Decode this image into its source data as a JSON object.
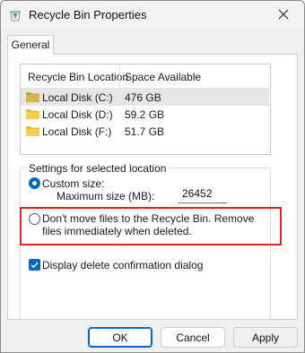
{
  "window": {
    "title": "Recycle Bin Properties",
    "icon": "recycle-bin-icon",
    "close_icon": "close-icon"
  },
  "tabs": [
    {
      "label": "General",
      "active": true
    }
  ],
  "list": {
    "columns": [
      "Recycle Bin Location",
      "Space Available"
    ],
    "rows": [
      {
        "location": "Local Disk (C:)",
        "space": "476 GB",
        "selected": true
      },
      {
        "location": "Local Disk (D:)",
        "space": "59.2 GB",
        "selected": false
      },
      {
        "location": "Local Disk (F:)",
        "space": "51.7 GB",
        "selected": false
      }
    ]
  },
  "settings": {
    "group_label": "Settings for selected location",
    "custom_size_label": "Custom size:",
    "custom_size_selected": true,
    "max_size_label": "Maximum size (MB):",
    "max_size_value": "26452",
    "dont_move_label": "Don't move files to the Recycle Bin. Remove files immediately when deleted.",
    "dont_move_selected": false,
    "confirm_label": "Display delete confirmation dialog",
    "confirm_checked": true
  },
  "buttons": {
    "ok": "OK",
    "cancel": "Cancel",
    "apply": "Apply"
  },
  "colors": {
    "accent": "#0067c0",
    "highlight": "#e3261c"
  }
}
